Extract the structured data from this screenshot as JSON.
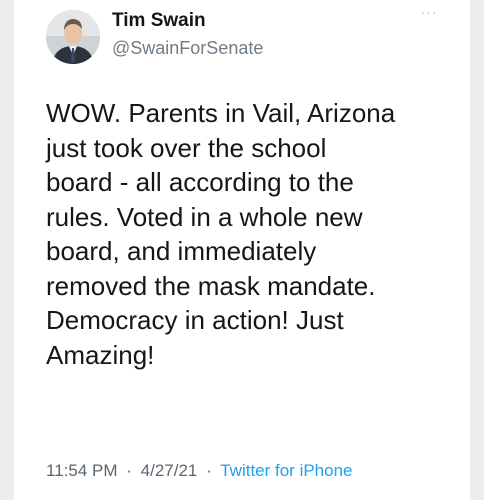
{
  "tweet": {
    "author_name": "Tim Swain",
    "handle": "@SwainForSenate",
    "more_icon": "ellipsis-icon",
    "more_glyph": "···",
    "text_lines": [
      "WOW. Parents in Vail, Arizona",
      "just took over the school",
      "board - all according to the",
      "rules.  Voted in a whole new",
      "board, and immediately",
      "removed the mask mandate.",
      "Democracy in action! Just",
      "Amazing!"
    ],
    "time": "11:54 PM",
    "separator": "·",
    "date": "4/27/21",
    "source": "Twitter for iPhone"
  },
  "colors": {
    "background": "#ececec",
    "card": "#ffffff",
    "text": "#14171a",
    "muted": "#6f7b86",
    "link": "#1da1f2"
  }
}
